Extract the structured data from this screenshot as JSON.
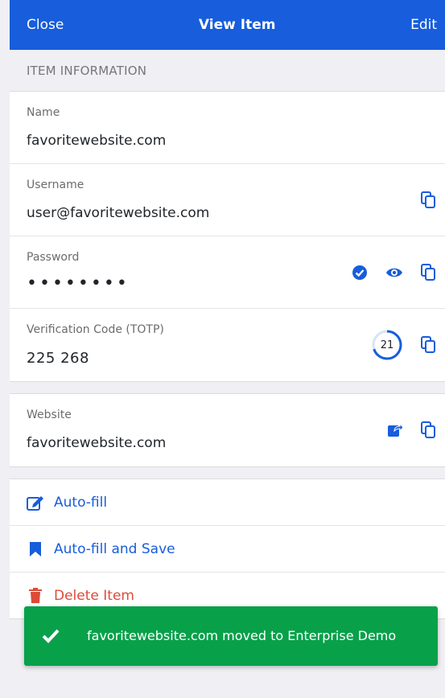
{
  "header": {
    "close_label": "Close",
    "title": "View Item",
    "edit_label": "Edit"
  },
  "section_title": "ITEM INFORMATION",
  "fields": {
    "name": {
      "label": "Name",
      "value": "favoritewebsite.com"
    },
    "username": {
      "label": "Username",
      "value": "user@favoritewebsite.com"
    },
    "password": {
      "label": "Password",
      "value": "••••••••"
    },
    "totp": {
      "label": "Verification Code (TOTP)",
      "value": "225  268",
      "countdown": "21",
      "countdown_fraction": 0.7
    }
  },
  "website": {
    "label": "Website",
    "value": "favoritewebsite.com"
  },
  "actions": {
    "autofill": "Auto-fill",
    "autofill_save": "Auto-fill and Save",
    "delete": "Delete Item"
  },
  "toast": {
    "message": "favoritewebsite.com moved to Enterprise Demo"
  },
  "colors": {
    "brand": "#175ddc",
    "success": "#08a14a",
    "danger": "#dd4b39",
    "background": "#efeff4"
  }
}
